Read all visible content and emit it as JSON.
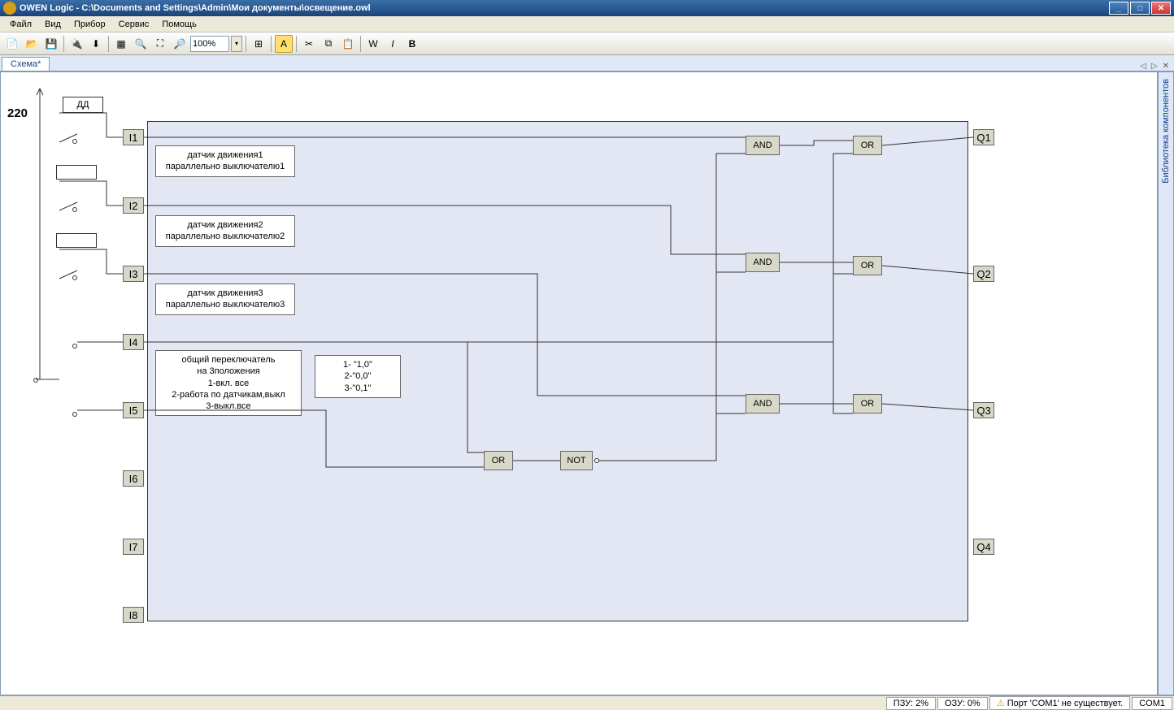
{
  "window": {
    "title": "OWEN Logic - C:\\Documents and Settings\\Admin\\Мои документы\\освещение.owl"
  },
  "menu": {
    "file": "Файл",
    "view": "Вид",
    "device": "Прибор",
    "service": "Сервис",
    "help": "Помощь"
  },
  "toolbar": {
    "zoom": "100%"
  },
  "tabs": {
    "main": "Схема*"
  },
  "side_panel": {
    "label": "Библиотека компонентов"
  },
  "statusbar": {
    "pzu": "ПЗУ: 2%",
    "ozu": "ОЗУ: 0%",
    "warn": "Порт 'COM1' не существует.",
    "com": "COM1"
  },
  "diagram": {
    "v220": "220",
    "dd": "ДД",
    "inputs": {
      "i1": "I1",
      "i2": "I2",
      "i3": "I3",
      "i4": "I4",
      "i5": "I5",
      "i6": "I6",
      "i7": "I7",
      "i8": "I8"
    },
    "outputs": {
      "q1": "Q1",
      "q2": "Q2",
      "q3": "Q3",
      "q4": "Q4"
    },
    "gates": {
      "and1": "AND",
      "and2": "AND",
      "and3": "AND",
      "or1": "OR",
      "or2": "OR",
      "or3": "OR",
      "or_bottom": "OR",
      "not": "NOT"
    },
    "notes": {
      "n1a": "датчик движения1",
      "n1b": "параллельно выключателю1",
      "n2a": "датчик движения2",
      "n2b": "параллельно выключателю2",
      "n3a": "датчик движения3",
      "n3b": "параллельно выключателю3",
      "n4_1": "общий переключатель",
      "n4_2": "на 3положения",
      "n4_3": "1-вкл. все",
      "n4_4": "2-работа по датчикам,выкл",
      "n4_5": "3-выкл.все",
      "n5_1": "1-  \"1,0\"",
      "n5_2": "2-\"0,0\"",
      "n5_3": "3-\"0,1\""
    }
  }
}
